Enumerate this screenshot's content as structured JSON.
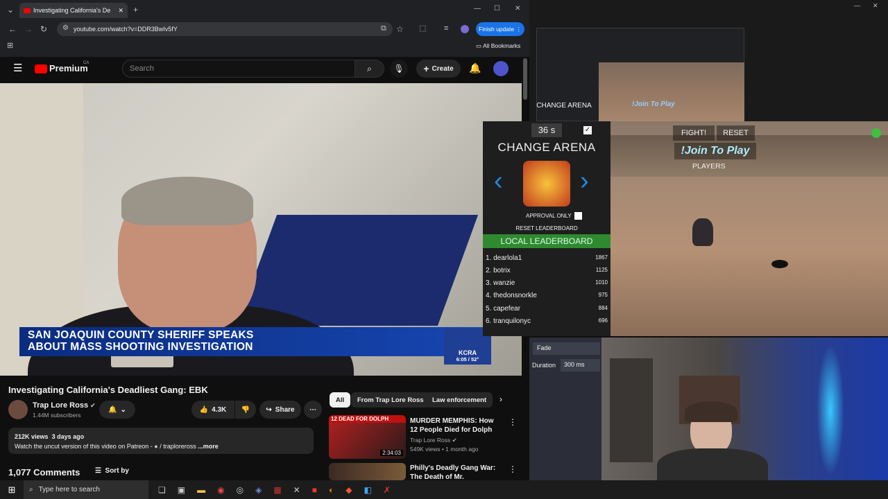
{
  "browser": {
    "tab_title": "Investigating California's De",
    "url": "youtube.com/watch?v=DDR3BwIv5fY",
    "finish_update": "Finish update",
    "bookmarks": "All Bookmarks"
  },
  "youtube": {
    "brand": "Premium",
    "region": "CA",
    "search_placeholder": "Search",
    "create_label": "Create",
    "banner_line1": "SAN JOAQUIN COUNTY SHERIFF SPEAKS",
    "banner_line2": "ABOUT MASS SHOOTING INVESTIGATION",
    "station": "KCRA",
    "station_time": "6:05 / 52°",
    "video_title": "Investigating California's Deadliest Gang: EBK",
    "channel": "Trap Lore Ross",
    "subscribers": "1.44M subscribers",
    "likes": "4.3K",
    "share": "Share",
    "views": "212K views",
    "age": "3 days ago",
    "description": "Watch the uncut version of this video on Patreon -",
    "patreon": "/ traploreross",
    "more": "...more",
    "comments": "1,077 Comments",
    "sort": "Sort by",
    "chips": [
      "All",
      "From Trap Lore Ross",
      "Law enforcement"
    ],
    "recs": [
      {
        "title": "MURDER MEMPHIS: How 12 People Died for Dolph",
        "channel": "Trap Lore Ross",
        "meta": "549K views • 1 month ago",
        "duration": "2:34:03",
        "thumb_text": "12 DEAD FOR DOLPH"
      },
      {
        "title": "Philly's Deadly Gang War: The Death of Mr. Disrespectful",
        "channel": "",
        "meta": "",
        "duration": "",
        "thumb_text": ""
      }
    ]
  },
  "stream": {
    "timer": "36 s",
    "change_arena": "CHANGE ARENA",
    "approval_only": "APPROVAL ONLY",
    "reset_leaderboard": "RESET LEADERBOARD",
    "local_leaderboard": "LOCAL LEADERBOARD",
    "fight": "FIGHT!",
    "reset": "RESET",
    "join": "!Join To Play",
    "players": "PLAYERS",
    "leaderboard": [
      {
        "rank": "1.",
        "name": "dearlola1",
        "score": "1867"
      },
      {
        "rank": "2.",
        "name": "botrix",
        "score": "1125"
      },
      {
        "rank": "3.",
        "name": "wanzie",
        "score": "1010"
      },
      {
        "rank": "4.",
        "name": "thedonsnorkle",
        "score": "975"
      },
      {
        "rank": "5.",
        "name": "capefear",
        "score": "884"
      },
      {
        "rank": "6.",
        "name": "tranquilonyc",
        "score": "696"
      }
    ],
    "obs": {
      "fade": "Fade",
      "duration_label": "Duration",
      "duration_value": "300 ms"
    }
  },
  "taskbar": {
    "search": "Type here to search"
  }
}
